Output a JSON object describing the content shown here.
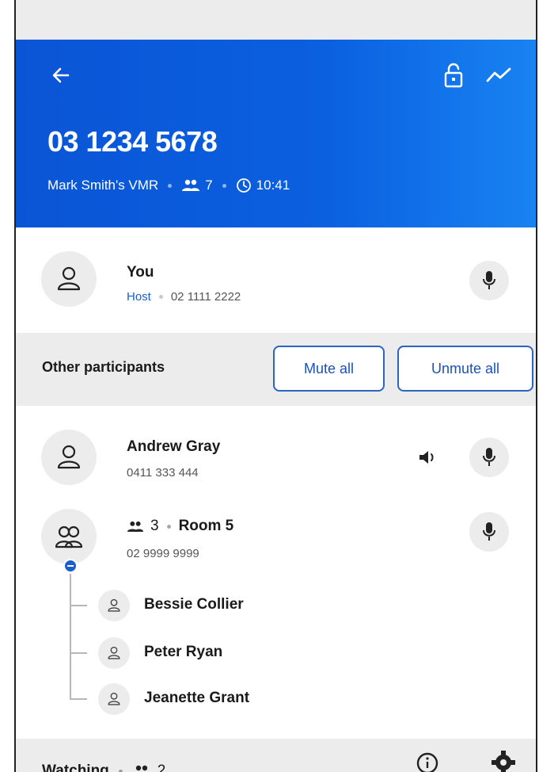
{
  "header": {
    "phone_number": "03 1234 5678",
    "vmr_name": "Mark Smith's VMR",
    "participant_count": "7",
    "duration": "10:41",
    "colors": {
      "gradient_start": "#0a55d6",
      "gradient_end": "#1883f2"
    },
    "icons": {
      "back": "arrow-left-icon",
      "lock": "unlock-icon",
      "stats": "stats-line-icon"
    }
  },
  "self": {
    "name": "You",
    "role": "Host",
    "phone": "02 1111 2222"
  },
  "other_section": {
    "title": "Other participants",
    "mute_all_label": "Mute all",
    "unmute_all_label": "Unmute all"
  },
  "participants": [
    {
      "name": "Andrew Gray",
      "phone": "0411 333 444",
      "speaking": true
    }
  ],
  "room": {
    "count": "3",
    "name": "Room 5",
    "phone": "02 9999 9999",
    "members": [
      "Bessie Collier",
      "Peter Ryan",
      "Jeanette Grant"
    ]
  },
  "footer": {
    "label": "Watching",
    "count": "2"
  }
}
